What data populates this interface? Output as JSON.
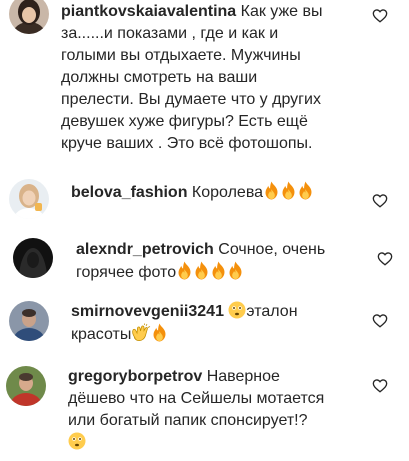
{
  "comments": [
    {
      "username": "piantkovskaiavalentina",
      "text_lines": [
        " Как уже вы",
        "за......и показами , где и как и",
        "голыми вы отдыхаете. Мужчины",
        "должны смотреть на ваши",
        "прелести. Вы думаете что у других",
        "девушек хуже фигуры? Есть ещё",
        "круче ваших . Это всё фотошопы."
      ],
      "avatar": "avatar-woman-dark-hair",
      "like_icon": "heart-outline-icon"
    },
    {
      "username": "belova_fashion",
      "text": " Королева",
      "emojis": [
        "fire-emoji",
        "fire-emoji",
        "fire-emoji"
      ],
      "avatar": "avatar-woman-light-hair",
      "like_icon": "heart-outline-icon"
    },
    {
      "username": "alexndr_petrovich",
      "text_lines": [
        " Сочное, очень",
        "горячее фото"
      ],
      "emojis": [
        "fire-emoji",
        "fire-emoji",
        "fire-emoji",
        "fire-emoji"
      ],
      "avatar": "avatar-hooded-dark",
      "like_icon": "heart-outline-icon"
    },
    {
      "username": "smirnovevgenii3241",
      "text_line1_suffix": "эталон",
      "text_line2": "красоты",
      "emojis": [
        "flushed-face-emoji",
        "clapping-hands-emoji",
        "fire-emoji"
      ],
      "avatar": "avatar-man-blue-jacket",
      "like_icon": "heart-outline-icon"
    },
    {
      "username": "gregoryborpetrov",
      "text_lines": [
        " Наверное",
        "дёшево что на Сейшелы мотается",
        "или богатый папик спонсирует!?"
      ],
      "emojis": [
        "flushed-face-emoji"
      ],
      "avatar": "avatar-man-red-shirt",
      "like_icon": "heart-outline-icon"
    }
  ],
  "colors": {
    "text": "#262626",
    "background": "#ffffff",
    "heart_stroke": "#262626",
    "fire_outer": "#f4900c",
    "fire_inner": "#ffcc4d",
    "emoji_face": "#ffcc4d"
  }
}
